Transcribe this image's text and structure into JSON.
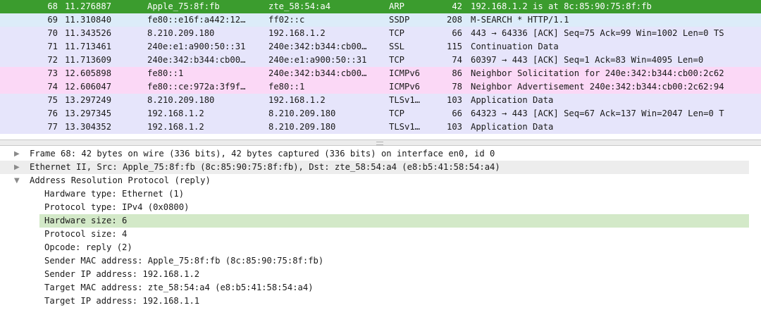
{
  "colors": {
    "selected_row": "#3b9c2e",
    "ssdp": "#dcecf9",
    "tcp_blue": "#e6e5fb",
    "ssl": "#e6e5fb",
    "icmpv6": "#fbd8f6",
    "detail_highlight": "#d3e9c8"
  },
  "packets": [
    {
      "no": "68",
      "time": "11.276887",
      "src": "Apple_75:8f:fb",
      "dst": "zte_58:54:a4",
      "proto": "ARP",
      "len": "42",
      "info": "192.168.1.2 is at 8c:85:90:75:8f:fb",
      "bg": "#3b9c2e",
      "selected": true
    },
    {
      "no": "69",
      "time": "11.310840",
      "src": "fe80::e16f:a442:12…",
      "dst": "ff02::c",
      "proto": "SSDP",
      "len": "208",
      "info": "M-SEARCH * HTTP/1.1",
      "bg": "#dcecf9"
    },
    {
      "no": "70",
      "time": "11.343526",
      "src": "8.210.209.180",
      "dst": "192.168.1.2",
      "proto": "TCP",
      "len": "66",
      "info": "443 → 64336 [ACK] Seq=75 Ack=99 Win=1002 Len=0 TS",
      "bg": "#e6e5fb"
    },
    {
      "no": "71",
      "time": "11.713461",
      "src": "240e:e1:a900:50::31",
      "dst": "240e:342:b344:cb00…",
      "proto": "SSL",
      "len": "115",
      "info": "Continuation Data",
      "bg": "#e6e5fb"
    },
    {
      "no": "72",
      "time": "11.713609",
      "src": "240e:342:b344:cb00…",
      "dst": "240e:e1:a900:50::31",
      "proto": "TCP",
      "len": "74",
      "info": "60397 → 443 [ACK] Seq=1 Ack=83 Win=4095 Len=0",
      "bg": "#e6e5fb"
    },
    {
      "no": "73",
      "time": "12.605898",
      "src": "fe80::1",
      "dst": "240e:342:b344:cb00…",
      "proto": "ICMPv6",
      "len": "86",
      "info": "Neighbor Solicitation for 240e:342:b344:cb00:2c62",
      "bg": "#fbd8f6"
    },
    {
      "no": "74",
      "time": "12.606047",
      "src": "fe80::ce:972a:3f9f…",
      "dst": "fe80::1",
      "proto": "ICMPv6",
      "len": "78",
      "info": "Neighbor Advertisement 240e:342:b344:cb00:2c62:94",
      "bg": "#fbd8f6"
    },
    {
      "no": "75",
      "time": "13.297249",
      "src": "8.210.209.180",
      "dst": "192.168.1.2",
      "proto": "TLSv1…",
      "len": "103",
      "info": "Application Data",
      "bg": "#e6e5fb"
    },
    {
      "no": "76",
      "time": "13.297345",
      "src": "192.168.1.2",
      "dst": "8.210.209.180",
      "proto": "TCP",
      "len": "66",
      "info": "64323 → 443 [ACK] Seq=67 Ack=137 Win=2047 Len=0 T",
      "bg": "#e6e5fb"
    },
    {
      "no": "77",
      "time": "13.304352",
      "src": "192.168.1.2",
      "dst": "8.210.209.180",
      "proto": "TLSv1…",
      "len": "103",
      "info": "Application Data",
      "bg": "#e6e5fb"
    }
  ],
  "details": {
    "frame": "Frame 68: 42 bytes on wire (336 bits), 42 bytes captured (336 bits) on interface en0, id 0",
    "ethernet": "Ethernet II, Src: Apple_75:8f:fb (8c:85:90:75:8f:fb), Dst: zte_58:54:a4 (e8:b5:41:58:54:a4)",
    "arp": "Address Resolution Protocol (reply)",
    "arp_fields": [
      "Hardware type: Ethernet (1)",
      "Protocol type: IPv4 (0x0800)",
      "Hardware size: 6",
      "Protocol size: 4",
      "Opcode: reply (2)",
      "Sender MAC address: Apple_75:8f:fb (8c:85:90:75:8f:fb)",
      "Sender IP address: 192.168.1.2",
      "Target MAC address: zte_58:54:a4 (e8:b5:41:58:54:a4)",
      "Target IP address: 192.168.1.1"
    ],
    "tree_icons": {
      "collapsed": "▶",
      "expanded": "▼"
    }
  }
}
